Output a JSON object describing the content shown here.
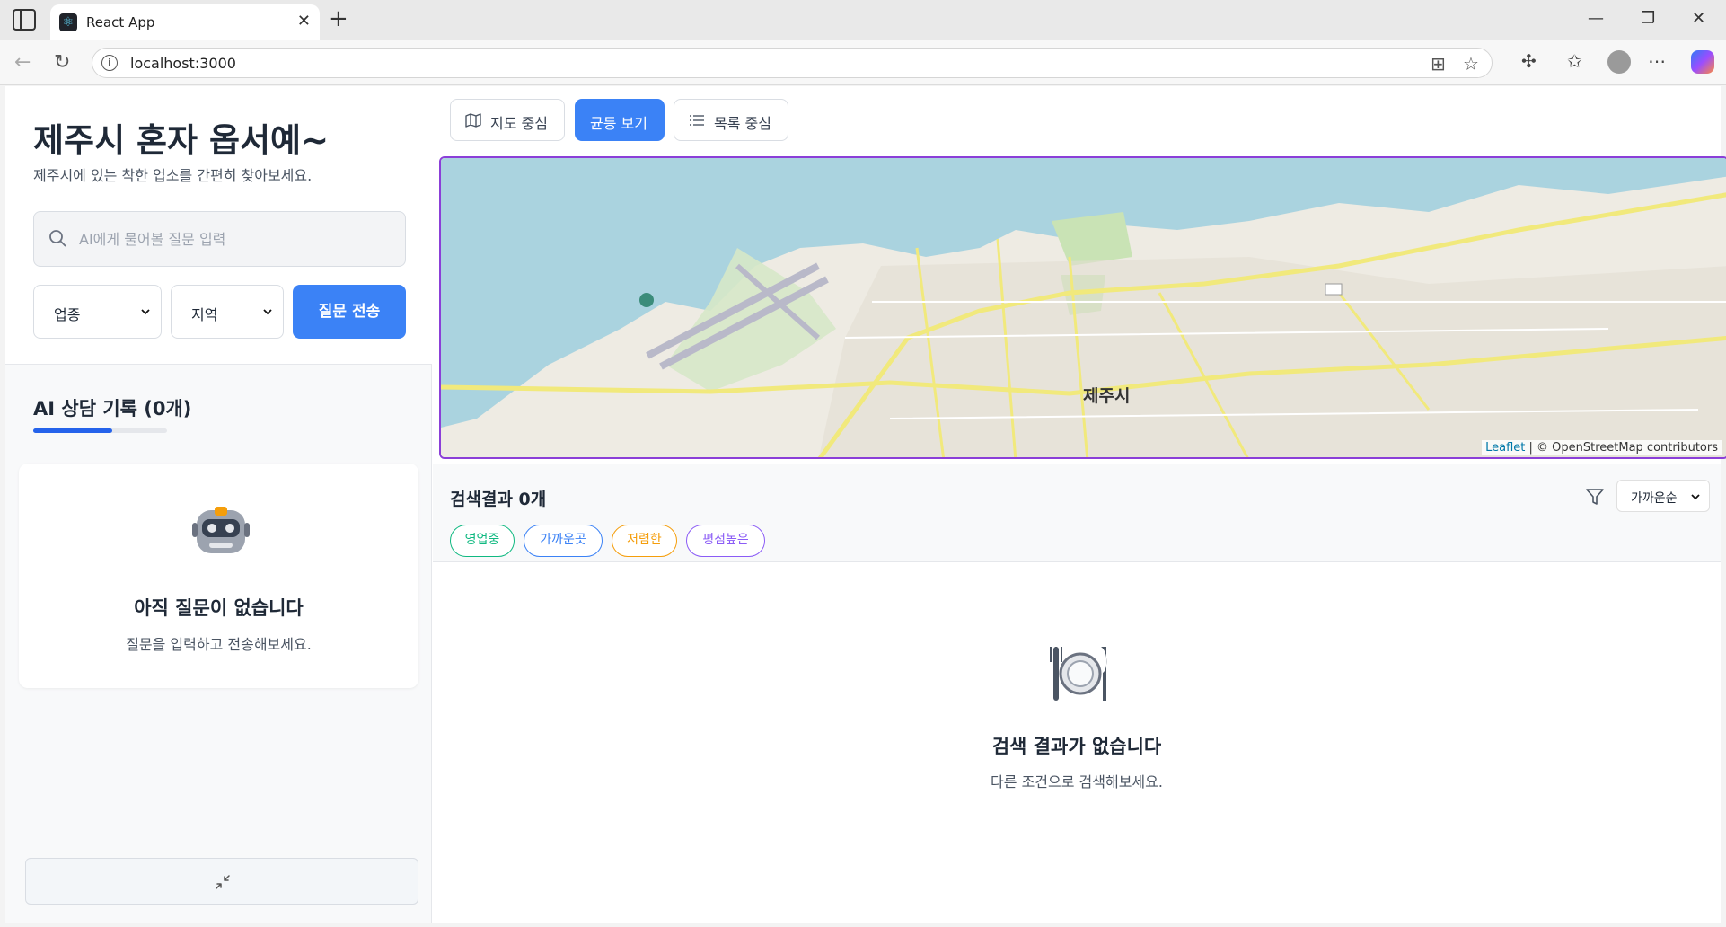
{
  "browser": {
    "tab_title": "React App",
    "url": "localhost:3000"
  },
  "sidebar": {
    "title": "제주시 혼자 옵서예~",
    "subtitle": "제주시에 있는 착한 업소를 간편히 찾아보세요.",
    "search_placeholder": "AI에게 물어볼 질문 입력",
    "category_select": "업종",
    "region_select": "지역",
    "submit_label": "질문 전송",
    "history_title": "AI 상담 기록 (0개)",
    "history_progress": 0.59,
    "empty_title": "아직 질문이 없습니다",
    "empty_sub": "질문을 입력하고 전송해보세요."
  },
  "main": {
    "view_buttons": [
      "지도 중심",
      "균등 보기",
      "목록 중심"
    ],
    "active_view": "균등 보기",
    "map": {
      "city_label": "제주시",
      "attribution_leaflet": "Leaflet",
      "attribution_rest": "| © OpenStreetMap contributors"
    },
    "results_title": "검색결과 0개",
    "chips": [
      {
        "label": "영업중",
        "color": "#10b981"
      },
      {
        "label": "가까운곳",
        "color": "#3b82f6"
      },
      {
        "label": "저렴한",
        "color": "#f59e0b"
      },
      {
        "label": "평점높은",
        "color": "#8b5cf6"
      }
    ],
    "sort_select": "가까운순",
    "empty_title": "검색 결과가 없습니다",
    "empty_sub": "다른 조건으로 검색해보세요."
  },
  "colors": {
    "accent": "#3b82f6",
    "map_border": "#8b3fd8"
  }
}
